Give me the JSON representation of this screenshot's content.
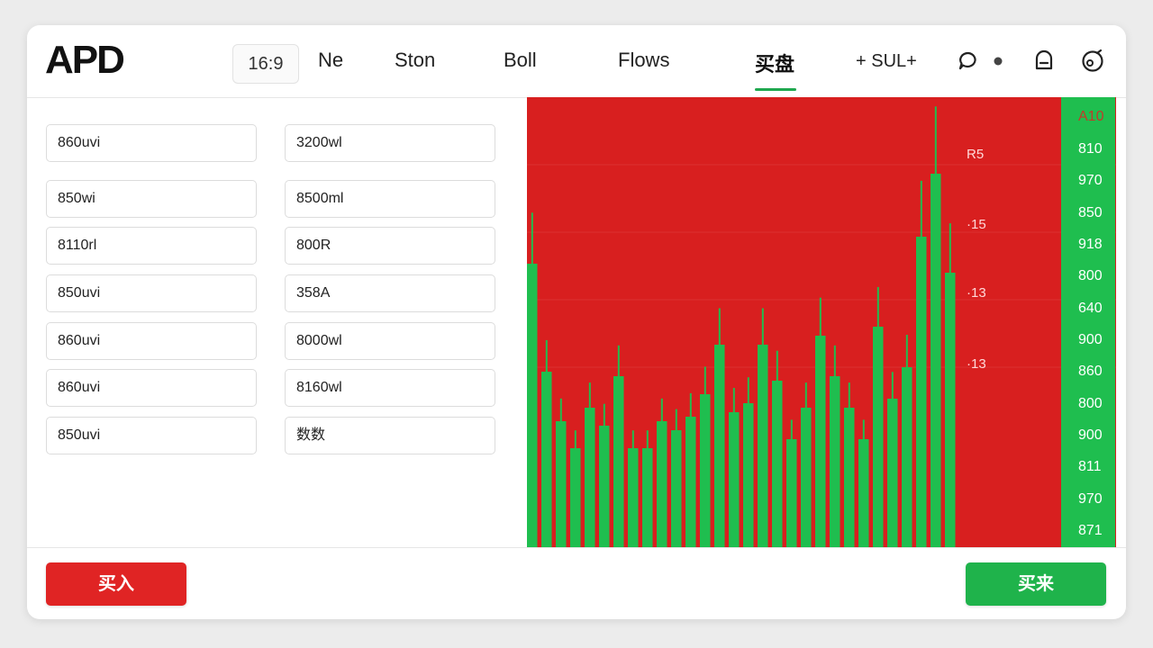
{
  "header": {
    "logo": "APD",
    "ratio": "16:9",
    "tabs": [
      {
        "label": "Ne"
      },
      {
        "label": "Ston"
      },
      {
        "label": "Boll"
      },
      {
        "label": "Flows"
      },
      {
        "label": "买盘"
      }
    ],
    "active_tab": "买盘",
    "sub_button": "+ SUL+",
    "icons": [
      "chat-icon",
      "dot-icon",
      "notification-icon",
      "settings-icon"
    ]
  },
  "form": {
    "left_column": [
      "860uvi",
      "850wi",
      "8110rl",
      "850uvi",
      "860uvi",
      "860uvi",
      "850uvi"
    ],
    "right_column": [
      "3200wl",
      "8500ml",
      "800R",
      "358A",
      "8000wl",
      "8160wl",
      "数数"
    ]
  },
  "chart_data": {
    "type": "bar",
    "colors": {
      "background": "#d81f1f",
      "bars": "#1fbe4f"
    },
    "y_tick_labels": [
      "A10",
      "810",
      "970",
      "850",
      "918",
      "800",
      "640",
      "900",
      "860",
      "800",
      "900",
      "811",
      "970",
      "871"
    ],
    "inner_labels": [
      "R5",
      "·15",
      "·13",
      "·13"
    ],
    "values": [
      0.63,
      0.39,
      0.28,
      0.22,
      0.31,
      0.27,
      0.38,
      0.22,
      0.22,
      0.28,
      0.26,
      0.29,
      0.34,
      0.45,
      0.3,
      0.32,
      0.45,
      0.37,
      0.24,
      0.31,
      0.47,
      0.38,
      0.31,
      0.24,
      0.49,
      0.33,
      0.4,
      0.69,
      0.83,
      0.61
    ]
  },
  "footer": {
    "buy_label": "买入",
    "sell_label": "买来"
  }
}
